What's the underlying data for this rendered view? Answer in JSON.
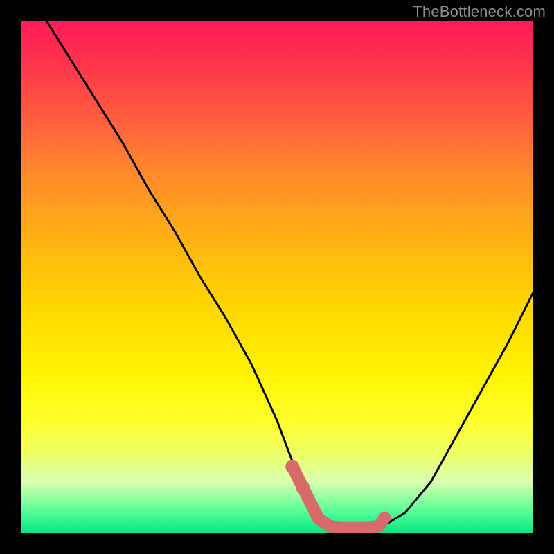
{
  "watermark": "TheBottleneck.com",
  "colors": {
    "black": "#000000",
    "curve": "#000000",
    "marker": "#d76a6a",
    "gradient_top": "#ff1a58",
    "gradient_bottom": "#00e884"
  },
  "chart_data": {
    "type": "line",
    "title": "",
    "xlabel": "",
    "ylabel": "",
    "xlim": [
      0,
      100
    ],
    "ylim": [
      0,
      100
    ],
    "grid": false,
    "legend": false,
    "x": [
      5,
      10,
      15,
      20,
      25,
      30,
      35,
      40,
      45,
      50,
      53,
      55,
      58,
      60,
      62,
      65,
      68,
      70,
      75,
      80,
      85,
      90,
      95,
      100
    ],
    "y": [
      100,
      92,
      84,
      76,
      67,
      59,
      50,
      42,
      33,
      22,
      14,
      9,
      4,
      2,
      1,
      0.5,
      0.5,
      1,
      4,
      10,
      19,
      28,
      37,
      47
    ],
    "markers": {
      "x": [
        53,
        55,
        58,
        60,
        62,
        64,
        66,
        68,
        70,
        71
      ],
      "y": [
        13,
        9,
        3,
        1.5,
        1,
        1,
        1,
        1,
        1.5,
        3
      ]
    }
  }
}
